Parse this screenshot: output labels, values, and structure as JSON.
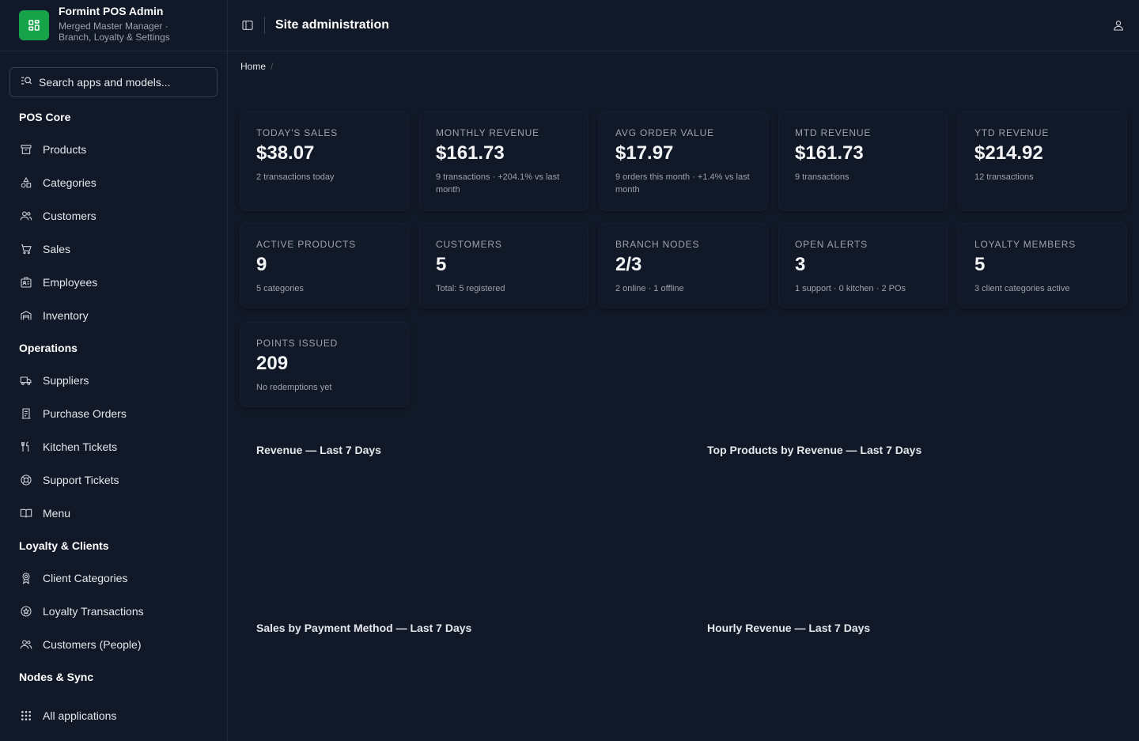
{
  "brand": {
    "title": "Formint POS Admin",
    "subtitle": "Merged Master Manager · Branch, Loyalty & Settings"
  },
  "search": {
    "placeholder": "Search apps and models..."
  },
  "sidebar": {
    "sections": [
      {
        "title": "POS Core",
        "items": [
          {
            "label": "Products",
            "icon": "archive-box-icon"
          },
          {
            "label": "Categories",
            "icon": "shapes-icon"
          },
          {
            "label": "Customers",
            "icon": "users-icon"
          },
          {
            "label": "Sales",
            "icon": "shopping-cart-icon"
          },
          {
            "label": "Employees",
            "icon": "id-badge-icon"
          },
          {
            "label": "Inventory",
            "icon": "warehouse-icon"
          }
        ]
      },
      {
        "title": "Operations",
        "items": [
          {
            "label": "Suppliers",
            "icon": "truck-icon"
          },
          {
            "label": "Purchase Orders",
            "icon": "receipt-icon"
          },
          {
            "label": "Kitchen Tickets",
            "icon": "utensils-icon"
          },
          {
            "label": "Support Tickets",
            "icon": "life-ring-icon"
          },
          {
            "label": "Menu",
            "icon": "book-open-icon"
          }
        ]
      },
      {
        "title": "Loyalty & Clients",
        "items": [
          {
            "label": "Client Categories",
            "icon": "award-icon"
          },
          {
            "label": "Loyalty Transactions",
            "icon": "star-circle-icon"
          },
          {
            "label": "Customers (People)",
            "icon": "users-icon"
          }
        ]
      },
      {
        "title": "Nodes & Sync",
        "items": []
      }
    ],
    "all_apps": {
      "label": "All applications",
      "icon": "grid-dots-icon"
    }
  },
  "header": {
    "title": "Site administration",
    "toggle_icon": "sidebar-toggle-icon",
    "user_icon": "user-icon"
  },
  "breadcrumb": {
    "home": "Home",
    "separator": "/"
  },
  "stats": [
    {
      "label": "Today's Sales",
      "value": "$38.07",
      "sub": "2 transactions today"
    },
    {
      "label": "Monthly Revenue",
      "value": "$161.73",
      "sub": "9 transactions · +204.1% vs last month"
    },
    {
      "label": "Avg Order Value",
      "value": "$17.97",
      "sub": "9 orders this month · +1.4% vs last month"
    },
    {
      "label": "MTD Revenue",
      "value": "$161.73",
      "sub": "9 transactions"
    },
    {
      "label": "YTD Revenue",
      "value": "$214.92",
      "sub": "12 transactions"
    },
    {
      "label": "Active Products",
      "value": "9",
      "sub": "5 categories"
    },
    {
      "label": "Customers",
      "value": "5",
      "sub": "Total: 5 registered"
    },
    {
      "label": "Branch Nodes",
      "value": "2/3",
      "sub": "2 online · 1 offline"
    },
    {
      "label": "Open Alerts",
      "value": "3",
      "sub": "1 support · 0 kitchen · 2 POs"
    },
    {
      "label": "Loyalty Members",
      "value": "5",
      "sub": "3 client categories active"
    },
    {
      "label": "Points Issued",
      "value": "209",
      "sub": "No redemptions yet"
    }
  ],
  "charts": {
    "revenue": "Revenue — Last 7 Days",
    "top_products": "Top Products by Revenue — Last 7 Days",
    "payment_methods": "Sales by Payment Method — Last 7 Days",
    "hourly": "Hourly Revenue — Last 7 Days"
  },
  "colors": {
    "background": "#111827",
    "brand_accent": "#16a34a",
    "border": "#1f2937"
  }
}
